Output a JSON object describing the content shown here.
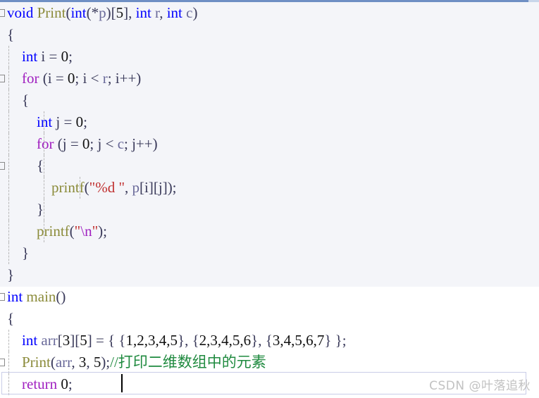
{
  "app": {
    "kind": "code-editor",
    "language": "C"
  },
  "watermark": {
    "text": "CSDN @叶落追秋"
  },
  "colors": {
    "keyword": "#0000FF",
    "control": "#A020C0",
    "function": "#8B8B3A",
    "string": "#C03030",
    "escape": "#A020C0",
    "comment": "#1F8A3F",
    "punctuation": "#3A3A5A",
    "variable": "#6A6A9A",
    "region_background": "#F4F5F9",
    "editor_background": "#FFFFFF",
    "top_rule": "#6F8FC4",
    "current_line_border": "#C9CDE8",
    "fold_marker": "#8A8A8A",
    "indent_guide": "#B8B8B8",
    "watermark": "#C2C2C2"
  },
  "editor": {
    "current_line_index": 16,
    "caret_visible": true,
    "fold_markers": [
      {
        "line": 0,
        "state": "expanded"
      },
      {
        "line": 3,
        "state": "expanded"
      },
      {
        "line": 7,
        "state": "expanded"
      },
      {
        "line": 13,
        "state": "expanded"
      },
      {
        "line": 16,
        "state": "expanded"
      }
    ]
  },
  "code": {
    "lines": [
      {
        "n": 1,
        "indent": 0,
        "text": "void Print(int(*p)[5], int r, int c)",
        "tokens": [
          {
            "t": "void",
            "c": "kw"
          },
          {
            "t": " ",
            "c": "plain"
          },
          {
            "t": "Print",
            "c": "fn"
          },
          {
            "t": "(",
            "c": "punc"
          },
          {
            "t": "int",
            "c": "kw"
          },
          {
            "t": "(*",
            "c": "punc"
          },
          {
            "t": "p",
            "c": "var"
          },
          {
            "t": ")[",
            "c": "punc"
          },
          {
            "t": "5",
            "c": "num"
          },
          {
            "t": "], ",
            "c": "punc"
          },
          {
            "t": "int",
            "c": "kw"
          },
          {
            "t": " ",
            "c": "plain"
          },
          {
            "t": "r",
            "c": "var"
          },
          {
            "t": ", ",
            "c": "punc"
          },
          {
            "t": "int",
            "c": "kw"
          },
          {
            "t": " ",
            "c": "plain"
          },
          {
            "t": "c",
            "c": "var"
          },
          {
            "t": ")",
            "c": "punc"
          }
        ]
      },
      {
        "n": 2,
        "indent": 0,
        "text": "{",
        "tokens": [
          {
            "t": "{",
            "c": "brace"
          }
        ]
      },
      {
        "n": 3,
        "indent": 1,
        "text": "    int i = 0;",
        "tokens": [
          {
            "t": "    ",
            "c": "plain"
          },
          {
            "t": "int",
            "c": "kw"
          },
          {
            "t": " i ",
            "c": "punc"
          },
          {
            "t": "= ",
            "c": "punc"
          },
          {
            "t": "0",
            "c": "num"
          },
          {
            "t": ";",
            "c": "punc"
          }
        ]
      },
      {
        "n": 4,
        "indent": 1,
        "text": "    for (i = 0; i < r; i++)",
        "tokens": [
          {
            "t": "    ",
            "c": "plain"
          },
          {
            "t": "for",
            "c": "ctl"
          },
          {
            "t": " (i = ",
            "c": "punc"
          },
          {
            "t": "0",
            "c": "num"
          },
          {
            "t": "; i < ",
            "c": "punc"
          },
          {
            "t": "r",
            "c": "var"
          },
          {
            "t": "; i++)",
            "c": "punc"
          }
        ]
      },
      {
        "n": 5,
        "indent": 1,
        "text": "    {",
        "tokens": [
          {
            "t": "    ",
            "c": "plain"
          },
          {
            "t": "{",
            "c": "brace"
          }
        ]
      },
      {
        "n": 6,
        "indent": 2,
        "text": "        int j = 0;",
        "tokens": [
          {
            "t": "        ",
            "c": "plain"
          },
          {
            "t": "int",
            "c": "kw"
          },
          {
            "t": " j ",
            "c": "punc"
          },
          {
            "t": "= ",
            "c": "punc"
          },
          {
            "t": "0",
            "c": "num"
          },
          {
            "t": ";",
            "c": "punc"
          }
        ]
      },
      {
        "n": 7,
        "indent": 2,
        "text": "        for (j = 0; j < c; j++)",
        "tokens": [
          {
            "t": "        ",
            "c": "plain"
          },
          {
            "t": "for",
            "c": "ctl"
          },
          {
            "t": " (j = ",
            "c": "punc"
          },
          {
            "t": "0",
            "c": "num"
          },
          {
            "t": "; j < ",
            "c": "punc"
          },
          {
            "t": "c",
            "c": "var"
          },
          {
            "t": "; j++)",
            "c": "punc"
          }
        ]
      },
      {
        "n": 8,
        "indent": 2,
        "text": "        {",
        "tokens": [
          {
            "t": "        ",
            "c": "plain"
          },
          {
            "t": "{",
            "c": "brace"
          }
        ]
      },
      {
        "n": 9,
        "indent": 3,
        "text": "            printf(\"%d \", p[i][j]);",
        "tokens": [
          {
            "t": "            ",
            "c": "plain"
          },
          {
            "t": "printf",
            "c": "fn"
          },
          {
            "t": "(",
            "c": "punc"
          },
          {
            "t": "\"%d \"",
            "c": "str"
          },
          {
            "t": ", ",
            "c": "punc"
          },
          {
            "t": "p",
            "c": "var"
          },
          {
            "t": "[i][j]);",
            "c": "punc"
          }
        ]
      },
      {
        "n": 10,
        "indent": 2,
        "text": "        }",
        "tokens": [
          {
            "t": "        ",
            "c": "plain"
          },
          {
            "t": "}",
            "c": "brace"
          }
        ]
      },
      {
        "n": 11,
        "indent": 2,
        "text": "        printf(\"\\n\");",
        "tokens": [
          {
            "t": "        ",
            "c": "plain"
          },
          {
            "t": "printf",
            "c": "fn"
          },
          {
            "t": "(",
            "c": "punc"
          },
          {
            "t": "\"",
            "c": "str"
          },
          {
            "t": "\\n",
            "c": "esc"
          },
          {
            "t": "\"",
            "c": "str"
          },
          {
            "t": ");",
            "c": "punc"
          }
        ]
      },
      {
        "n": 12,
        "indent": 1,
        "text": "    }",
        "tokens": [
          {
            "t": "    ",
            "c": "plain"
          },
          {
            "t": "}",
            "c": "brace"
          }
        ]
      },
      {
        "n": 13,
        "indent": 0,
        "text": "}",
        "tokens": [
          {
            "t": "}",
            "c": "brace"
          }
        ]
      },
      {
        "n": 14,
        "indent": 0,
        "text": "int main()",
        "tokens": [
          {
            "t": "int",
            "c": "kw"
          },
          {
            "t": " ",
            "c": "plain"
          },
          {
            "t": "main",
            "c": "fn"
          },
          {
            "t": "()",
            "c": "punc"
          }
        ]
      },
      {
        "n": 15,
        "indent": 0,
        "text": "{",
        "tokens": [
          {
            "t": "{",
            "c": "brace"
          }
        ]
      },
      {
        "n": 16,
        "indent": 1,
        "text": "    int arr[3][5] = { {1,2,3,4,5}, {2,3,4,5,6}, {3,4,5,6,7} };",
        "tokens": [
          {
            "t": "    ",
            "c": "plain"
          },
          {
            "t": "int",
            "c": "kw"
          },
          {
            "t": " ",
            "c": "plain"
          },
          {
            "t": "arr",
            "c": "var"
          },
          {
            "t": "[",
            "c": "punc"
          },
          {
            "t": "3",
            "c": "num"
          },
          {
            "t": "][",
            "c": "punc"
          },
          {
            "t": "5",
            "c": "num"
          },
          {
            "t": "] = { {",
            "c": "punc"
          },
          {
            "t": "1,2,3,4,5",
            "c": "num"
          },
          {
            "t": "}, {",
            "c": "punc"
          },
          {
            "t": "2,3,4,5,6",
            "c": "num"
          },
          {
            "t": "}, {",
            "c": "punc"
          },
          {
            "t": "3,4,5,6,7",
            "c": "num"
          },
          {
            "t": "} };",
            "c": "punc"
          }
        ]
      },
      {
        "n": 17,
        "indent": 1,
        "text": "    Print(arr, 3, 5);//打印二维数组中的元素",
        "tokens": [
          {
            "t": "    ",
            "c": "plain"
          },
          {
            "t": "Print",
            "c": "fn"
          },
          {
            "t": "(",
            "c": "punc"
          },
          {
            "t": "arr",
            "c": "var"
          },
          {
            "t": ", ",
            "c": "punc"
          },
          {
            "t": "3",
            "c": "num"
          },
          {
            "t": ", ",
            "c": "punc"
          },
          {
            "t": "5",
            "c": "num"
          },
          {
            "t": ");",
            "c": "punc"
          },
          {
            "t": "//打印二维数组中的元素",
            "c": "cmt"
          }
        ]
      },
      {
        "n": 18,
        "indent": 1,
        "text": "    return 0;",
        "tokens": [
          {
            "t": "    ",
            "c": "plain"
          },
          {
            "t": "return",
            "c": "ctl"
          },
          {
            "t": " ",
            "c": "plain"
          },
          {
            "t": "0",
            "c": "num"
          },
          {
            "t": ";",
            "c": "punc"
          }
        ]
      }
    ]
  }
}
